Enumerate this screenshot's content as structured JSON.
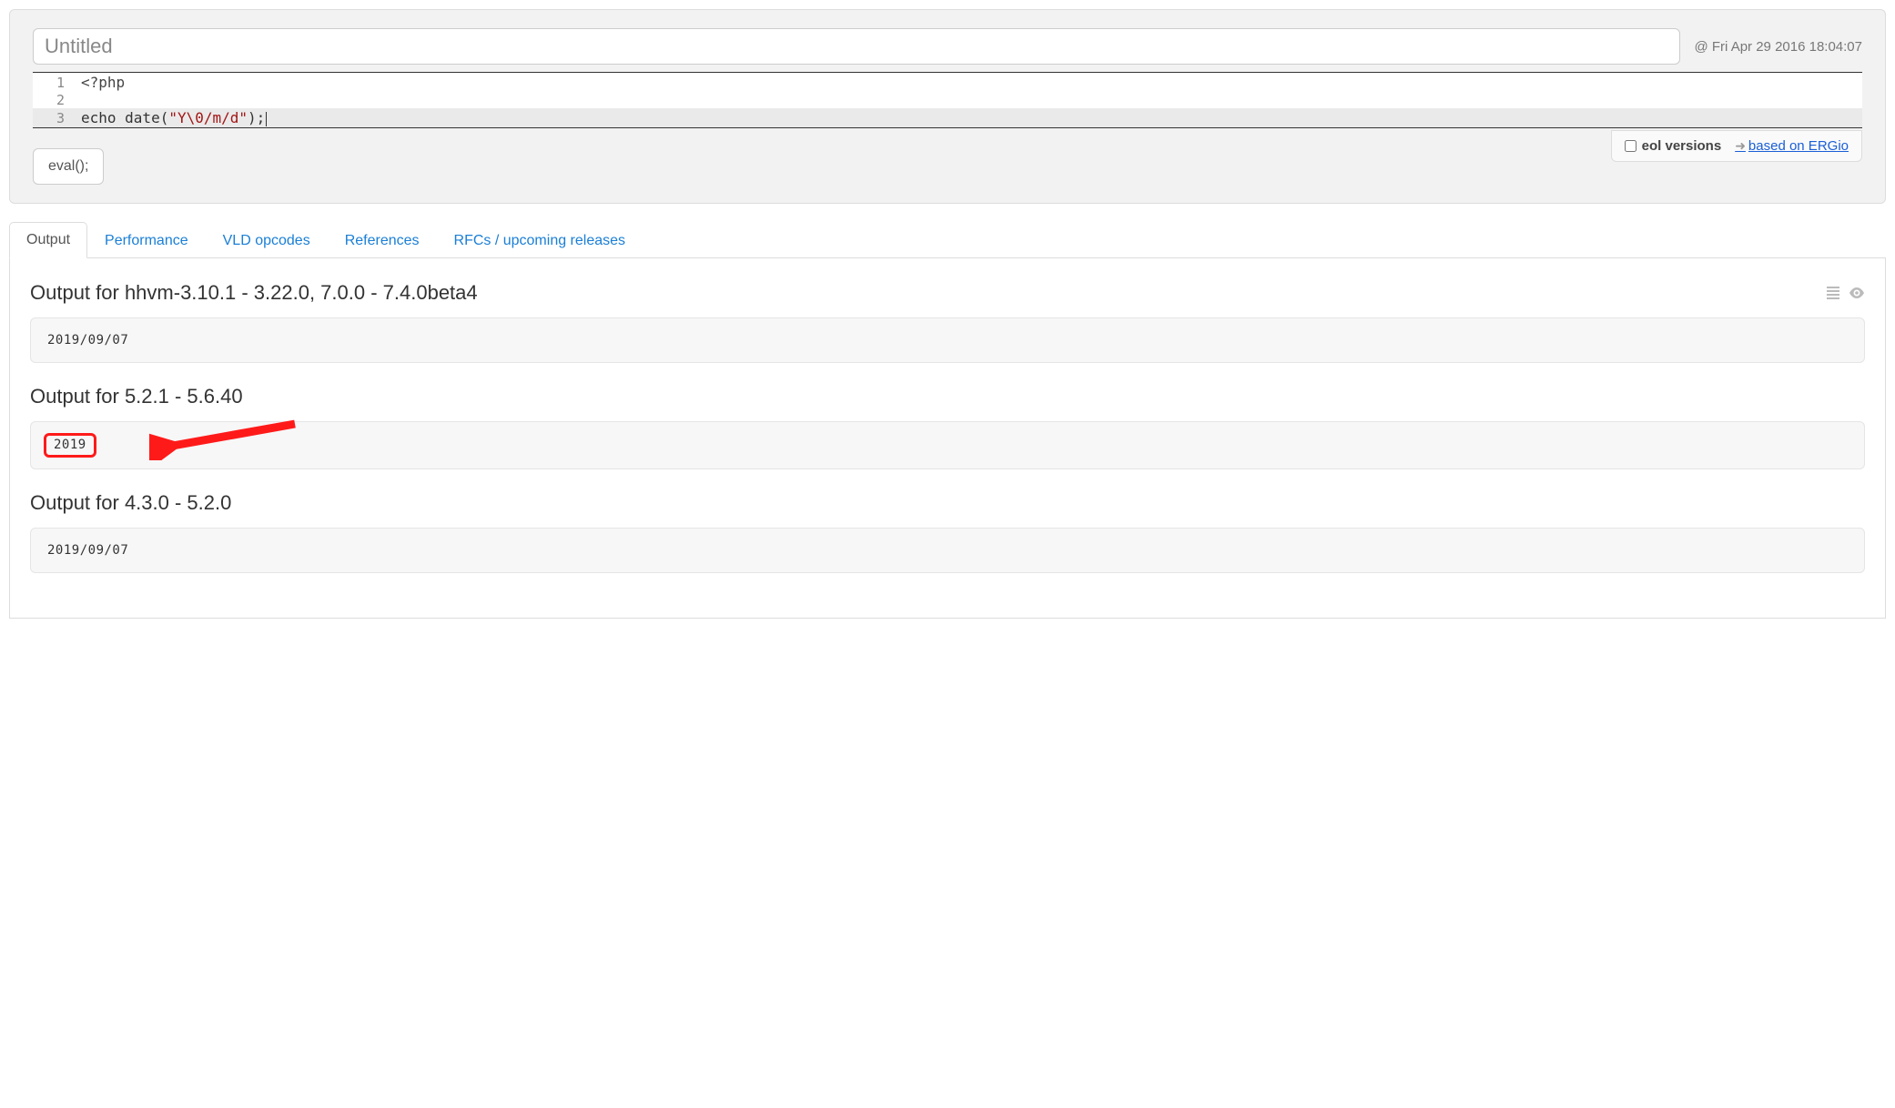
{
  "header": {
    "title_placeholder": "Untitled",
    "timestamp": "@ Fri Apr 29 2016 18:04:07"
  },
  "code": {
    "lines": [
      {
        "n": "1",
        "html": "<?php"
      },
      {
        "n": "2",
        "html": ""
      },
      {
        "n": "3",
        "html": "echo date(\"Y\\0/m/d\");"
      }
    ]
  },
  "controls": {
    "eval_label": "eval();",
    "eol_label": "eol versions",
    "based_on_label": "based on ERGio"
  },
  "tabs": {
    "items": [
      {
        "label": "Output",
        "active": true
      },
      {
        "label": "Performance",
        "active": false
      },
      {
        "label": "VLD opcodes",
        "active": false
      },
      {
        "label": "References",
        "active": false
      },
      {
        "label": "RFCs / upcoming releases",
        "active": false
      }
    ]
  },
  "outputs": [
    {
      "heading": "Output for hhvm-3.10.1 - 3.22.0, 7.0.0 - 7.4.0beta4",
      "value": "2019/09/07",
      "highlighted": false,
      "icons": true
    },
    {
      "heading": "Output for 5.2.1 - 5.6.40",
      "value": "2019",
      "highlighted": true,
      "icons": false
    },
    {
      "heading": "Output for 4.3.0 - 5.2.0",
      "value": "2019/09/07",
      "highlighted": false,
      "icons": false
    }
  ]
}
